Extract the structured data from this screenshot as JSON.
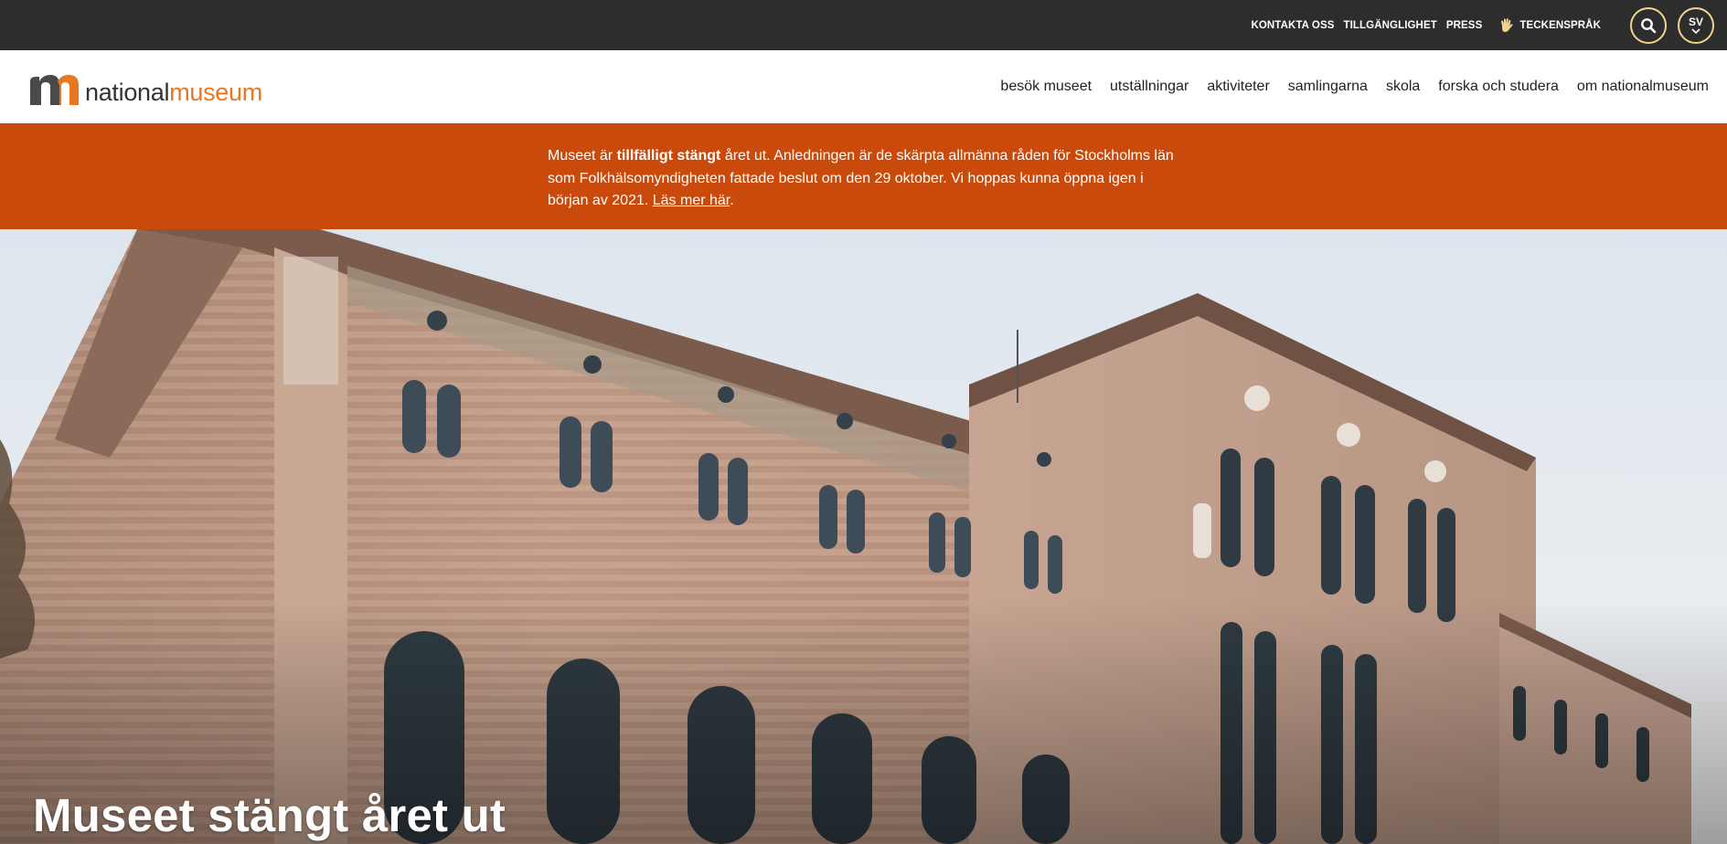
{
  "topbar": {
    "links": [
      "KONTAKTA OSS",
      "TILLGÄNGLIGHET",
      "PRESS"
    ],
    "sign_language": "TECKENSPRÅK",
    "search_icon": "search-icon",
    "language": "SV",
    "colors": {
      "background": "#2d2d2d",
      "button_ring": "#f3d28b"
    }
  },
  "header": {
    "logo_part1": "national",
    "logo_part2": "museum",
    "logo_colors": {
      "mark_dark": "#4a4a4a",
      "mark_orange": "#e87722"
    },
    "nav": [
      "besök museet",
      "utställningar",
      "aktiviteter",
      "samlingarna",
      "skola",
      "forska och studera",
      "om nationalmuseum"
    ]
  },
  "notice": {
    "background": "#c94a0a",
    "text_before": "Museet är ",
    "text_bold": "tillfälligt stängt",
    "text_after": " året ut. Anledningen är de skärpta allmänna råden för Stockholms län som Folkhälsomyndigheten fattade beslut om den 29 oktober. Vi hoppas kunna öppna igen i början av 2021. ",
    "link": "Läs mer här",
    "period": "."
  },
  "hero": {
    "title": "Museet stängt året ut",
    "image": "museum-building-photo"
  }
}
